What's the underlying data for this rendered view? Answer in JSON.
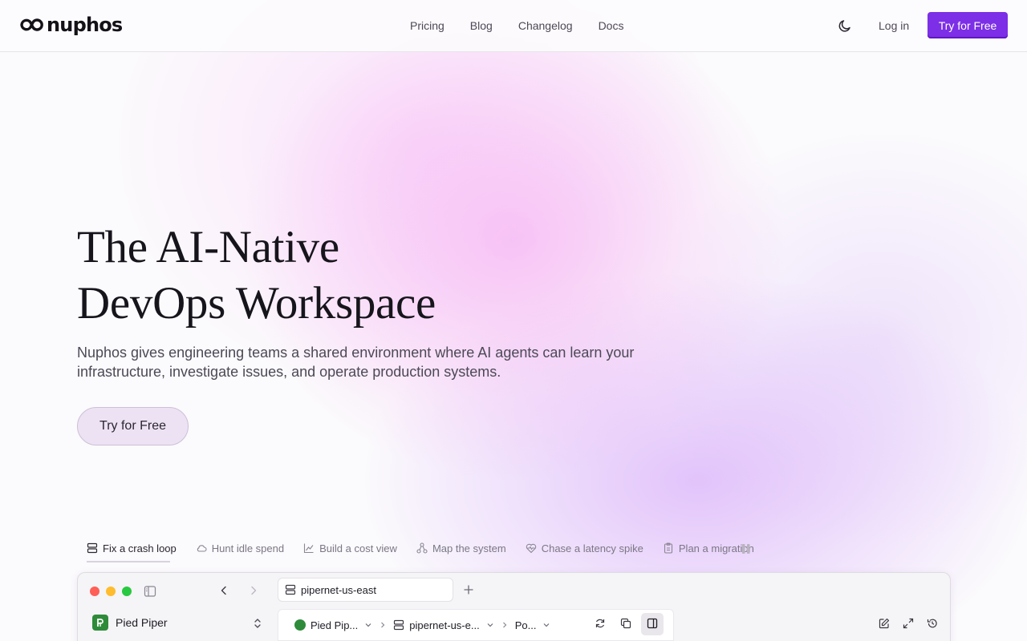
{
  "brand": {
    "name": "nuphos"
  },
  "nav": {
    "items": [
      "Pricing",
      "Blog",
      "Changelog",
      "Docs"
    ]
  },
  "header": {
    "login": "Log in",
    "cta": "Try for Free"
  },
  "hero": {
    "title_line1": "The AI-Native",
    "title_line2": "DevOps Workspace",
    "subtitle_line1": "Nuphos gives engineering teams a shared environment where AI agents can learn your",
    "subtitle_line2": "infrastructure, investigate issues, and operate production systems.",
    "cta": "Try for Free"
  },
  "demo_tabs": [
    {
      "label": "Fix a crash loop",
      "icon": "server-icon",
      "active": true
    },
    {
      "label": "Hunt idle spend",
      "icon": "cloud-icon",
      "active": false
    },
    {
      "label": "Build a cost view",
      "icon": "chart-icon",
      "active": false
    },
    {
      "label": "Map the system",
      "icon": "network-icon",
      "active": false
    },
    {
      "label": "Chase a latency spike",
      "icon": "heart-pulse-icon",
      "active": false
    },
    {
      "label": "Plan a migration",
      "icon": "clipboard-icon",
      "active": false
    }
  ],
  "app": {
    "tab_title": "pipernet-us-east",
    "workspace": "Pied Piper",
    "breadcrumbs": [
      "Pied Pip...",
      "pipernet-us-e...",
      "Po..."
    ]
  },
  "colors": {
    "accent": "#7c2fe6",
    "traffic_red": "#fe5f57",
    "traffic_yellow": "#febc2e",
    "traffic_green": "#28c840",
    "workspace_green": "#2e8b3a"
  }
}
